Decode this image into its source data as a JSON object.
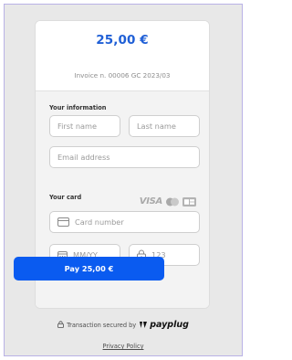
{
  "header": {
    "amount": "25,00 €",
    "invoice": "Invoice n. 00006 GC 2023/03"
  },
  "info": {
    "label": "Your information",
    "first_name_placeholder": "First name",
    "last_name_placeholder": "Last name",
    "email_placeholder": "Email address"
  },
  "card": {
    "label": "Your card",
    "brands": [
      "VISA",
      "mastercard-icon",
      "cb-card-icon"
    ],
    "number_placeholder": "Card number",
    "expiry_placeholder": "MM/YY",
    "cvc_placeholder": "123"
  },
  "pay_button": {
    "label": "Pay 25,00 €",
    "color": "#0a5bf0"
  },
  "footer": {
    "secured_text": "Transaction secured by",
    "brand": "payplug",
    "privacy_link": "Privacy Policy"
  },
  "colors": {
    "amount": "#1f5fd6",
    "background": "#e8e8e8"
  }
}
